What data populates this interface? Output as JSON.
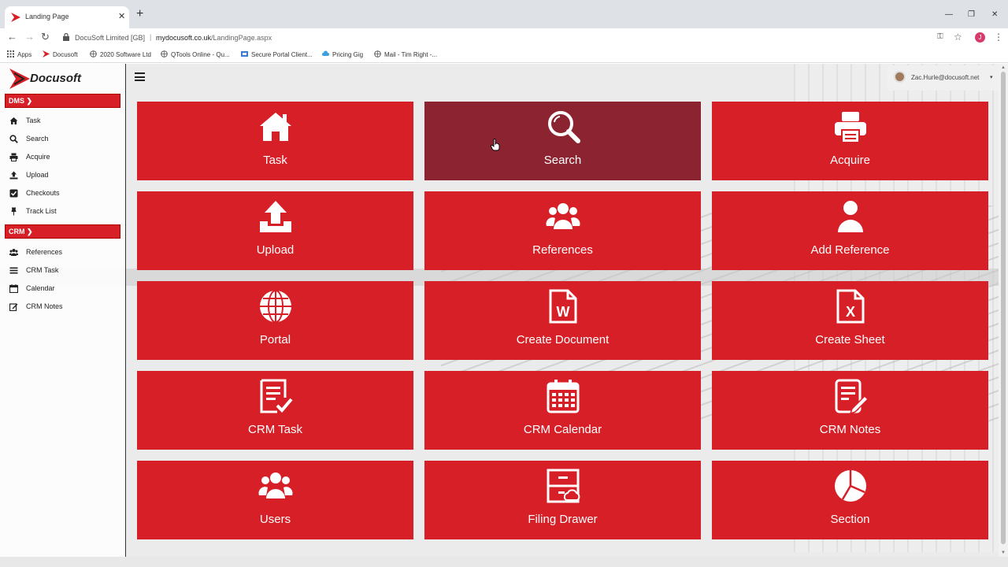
{
  "browser": {
    "tab_title": "Landing Page",
    "tab_close": "✕",
    "new_tab": "+",
    "window_controls": {
      "minimize": "—",
      "restore": "❐",
      "close": "✕"
    },
    "nav": {
      "back": "←",
      "forward": "→",
      "reload": "↻"
    },
    "url_site": "DocuSoft Limited [GB]",
    "url_sep": "|",
    "url_domain": "mydocusoft.co.uk",
    "url_path": "/LandingPage.aspx",
    "profile_initial": "J",
    "bookmarks": [
      {
        "label": "Apps",
        "icon": "apps-grid-icon"
      },
      {
        "label": "Docusoft",
        "icon": "docusoft-icon"
      },
      {
        "label": "2020 Software Ltd",
        "icon": "globe-icon"
      },
      {
        "label": "QTools Online - Qu...",
        "icon": "globe-icon"
      },
      {
        "label": "Secure Portal Client...",
        "icon": "portal-icon"
      },
      {
        "label": "Pricing Gig",
        "icon": "cloud-icon"
      },
      {
        "label": "Mail - Tim Right -...",
        "icon": "globe-icon"
      }
    ]
  },
  "sidebar": {
    "logo_text": "Docusoft",
    "dms_label": "DMS ❯",
    "crm_label": "CRM ❯",
    "dms_items": [
      {
        "label": "Task",
        "icon": "home-icon"
      },
      {
        "label": "Search",
        "icon": "search-icon"
      },
      {
        "label": "Acquire",
        "icon": "printer-icon"
      },
      {
        "label": "Upload",
        "icon": "upload-icon"
      },
      {
        "label": "Checkouts",
        "icon": "checkbox-icon"
      },
      {
        "label": "Track List",
        "icon": "pin-icon"
      }
    ],
    "crm_items": [
      {
        "label": "References",
        "icon": "users-icon"
      },
      {
        "label": "CRM Task",
        "icon": "list-icon"
      },
      {
        "label": "Calendar",
        "icon": "calendar-icon"
      },
      {
        "label": "CRM Notes",
        "icon": "edit-icon"
      }
    ]
  },
  "header": {
    "user_email": "Zac.Hurle@docusoft.net",
    "user_caret": "▾"
  },
  "tiles": [
    {
      "label": "Task",
      "icon": "home-icon"
    },
    {
      "label": "Search",
      "icon": "search-icon",
      "active": true
    },
    {
      "label": "Acquire",
      "icon": "printer-icon"
    },
    {
      "label": "Upload",
      "icon": "upload-icon"
    },
    {
      "label": "References",
      "icon": "users-icon"
    },
    {
      "label": "Add Reference",
      "icon": "user-icon"
    },
    {
      "label": "Portal",
      "icon": "globe-icon"
    },
    {
      "label": "Create Document",
      "icon": "word-file-icon"
    },
    {
      "label": "Create Sheet",
      "icon": "excel-file-icon"
    },
    {
      "label": "CRM Task",
      "icon": "task-list-icon"
    },
    {
      "label": "CRM Calendar",
      "icon": "calendar-icon"
    },
    {
      "label": "CRM Notes",
      "icon": "notes-icon"
    },
    {
      "label": "Users",
      "icon": "users-icon"
    },
    {
      "label": "Filing Drawer",
      "icon": "filing-drawer-icon"
    },
    {
      "label": "Section",
      "icon": "pie-chart-icon"
    }
  ],
  "colors": {
    "brand_red": "#d71f27",
    "active_tile": "#8c2330",
    "tile_text": "#ffffff"
  }
}
